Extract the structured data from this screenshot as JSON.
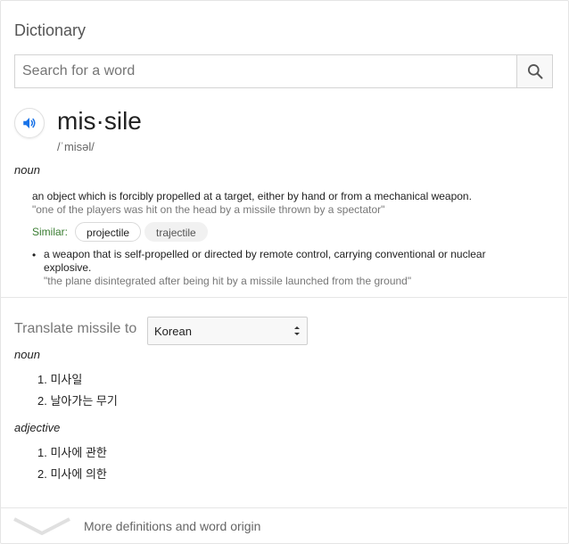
{
  "header": {
    "title": "Dictionary"
  },
  "search": {
    "placeholder": "Search for a word",
    "value": "",
    "icon": "search-icon"
  },
  "entry": {
    "word": "mis·sile",
    "phonetic": "/ˈmisəl/",
    "audio_icon": "speaker-icon",
    "part_of_speech": "noun",
    "senses": [
      {
        "definition": "an object which is forcibly propelled at a target, either by hand or from a mechanical weapon.",
        "example": "\"one of the players was hit on the head by a missile thrown by a spectator\"",
        "similar_label": "Similar:",
        "similar": [
          "projectile",
          "trajectile"
        ]
      },
      {
        "bullet": "•",
        "definition_line1": "a weapon that is self-propelled or directed by remote control, carrying conventional or nuclear",
        "definition_line2": "explosive.",
        "example": "\"the plane disintegrated after being hit by a missile launched from the ground\""
      }
    ]
  },
  "translate": {
    "label": "Translate missile to",
    "language": "Korean",
    "groups": [
      {
        "pos": "noun",
        "items": [
          "1. 미사일",
          "2. 날아가는 무기"
        ]
      },
      {
        "pos": "adjective",
        "items": [
          "1. 미사에 관한",
          "2. 미사에 의한"
        ]
      }
    ]
  },
  "footer": {
    "more_label": "More definitions and word origin",
    "chevron_icon": "chevron-down-icon"
  },
  "colors": {
    "accent_blue": "#1a73e8",
    "similar_green": "#3a7d32"
  }
}
